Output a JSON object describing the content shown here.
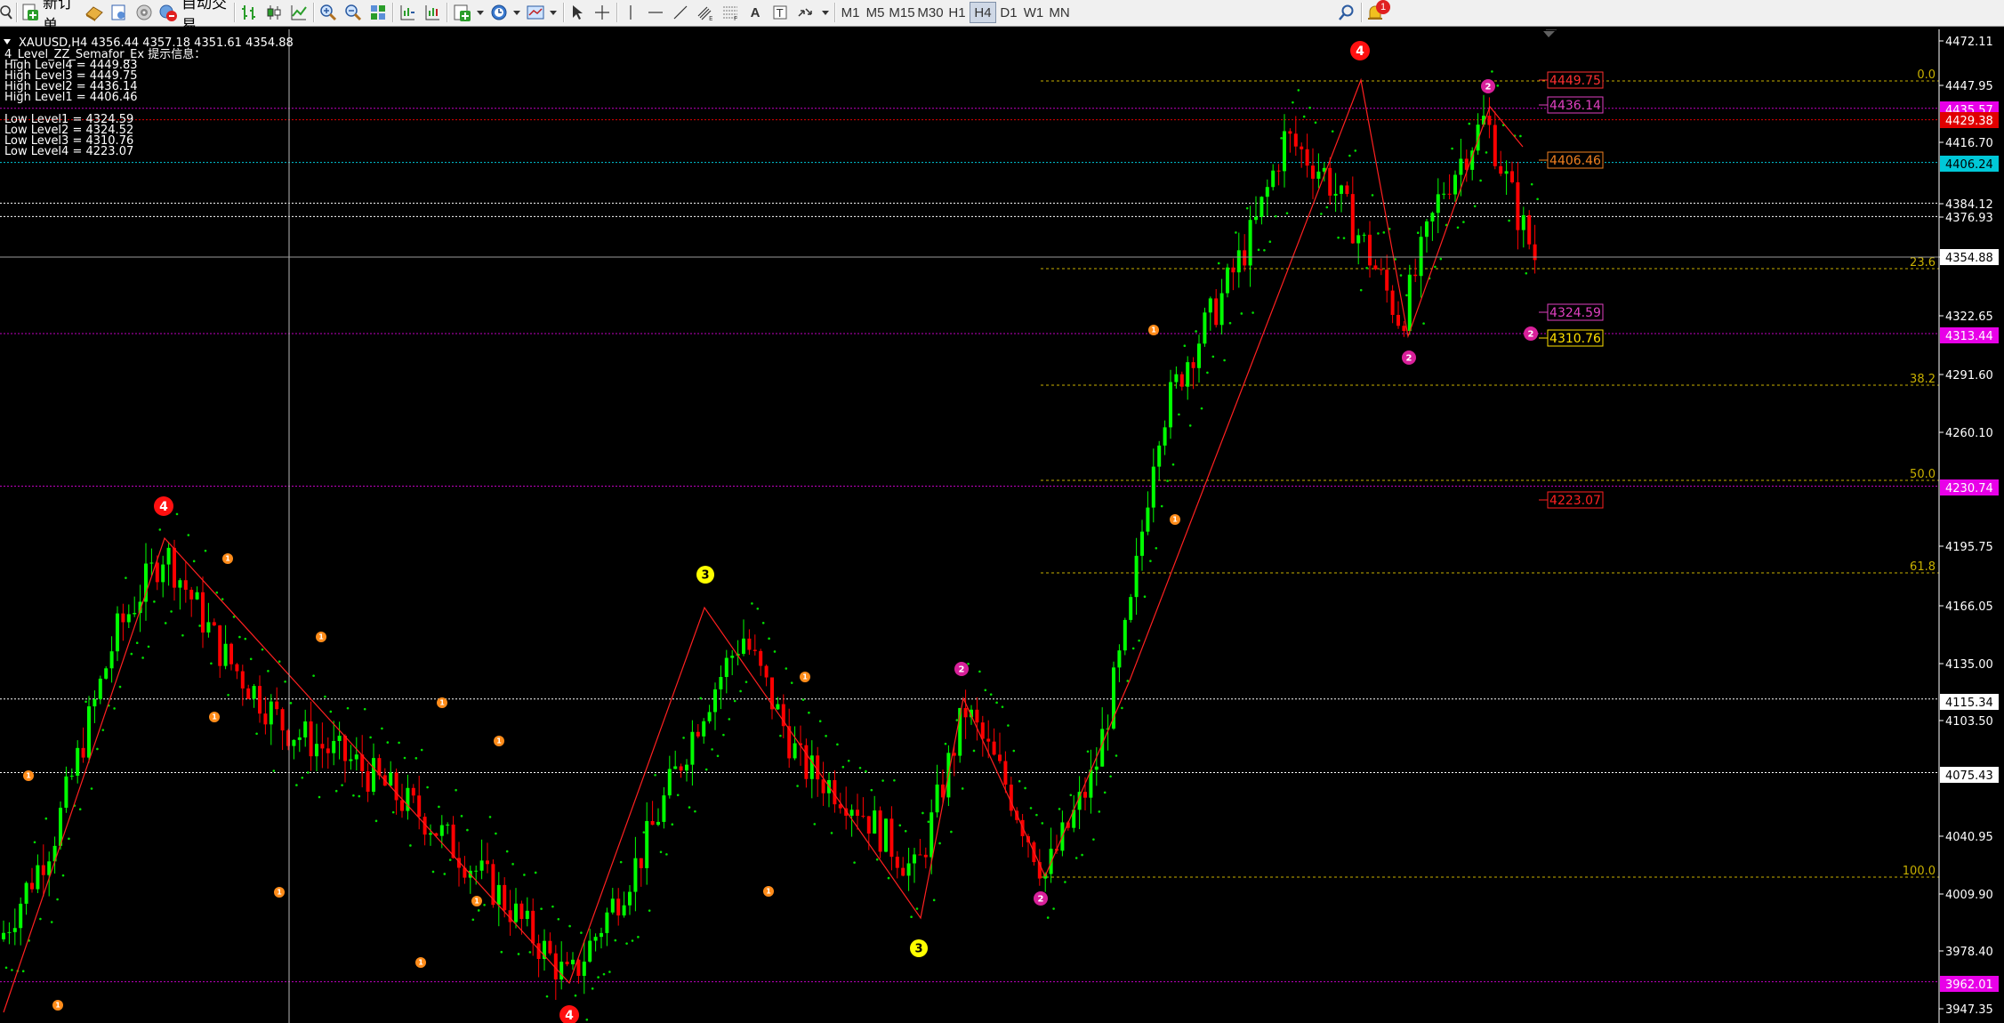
{
  "toolbar": {
    "new_order": "新订单",
    "auto_trade": "自动交易",
    "timeframes": [
      "M1",
      "M5",
      "M15",
      "M30",
      "H1",
      "H4",
      "D1",
      "W1",
      "MN"
    ],
    "active_timeframe": "H4",
    "notification_count": "1",
    "icons": [
      "zoom-icon",
      "new-order-icon",
      "market-watch-icon",
      "navigator-icon",
      "signal-icon",
      "auto-trading-icon",
      "bar-chart-icon",
      "candle-chart-icon",
      "line-chart-icon",
      "zoom-in-icon",
      "zoom-out-icon",
      "tile-windows-icon",
      "chart-shift-icon",
      "autoscroll-icon",
      "indicators-icon",
      "periods-icon",
      "templates-icon",
      "cursor-icon",
      "crosshair-icon",
      "vertical-line-icon",
      "horizontal-line-icon",
      "trendline-icon",
      "equidistant-channel-icon",
      "fibonacci-icon",
      "text-icon",
      "text-label-icon",
      "arrows-icon",
      "search-icon",
      "notification-icon"
    ]
  },
  "chart": {
    "header": "XAUUSD,H4  4356.44 4357.18 4351.61 4354.88",
    "indicator_title": "4_Level_ZZ_Semafor_Ex 提示信息：",
    "high_levels": [
      "High Level4 = 4449.83",
      "High Level3 = 4449.75",
      "High Level2 = 4436.14",
      "High Level1 = 4406.46"
    ],
    "low_levels": [
      "Low Level1 = 4324.59",
      "Low Level2 = 4324.52",
      "Low Level3 = 4310.76",
      "Low Level4 = 4223.07"
    ],
    "price_labels": [
      "4472.11",
      "4447.95",
      "4416.70",
      "4384.12",
      "4376.93",
      "4354.88",
      "4322.65",
      "4291.60",
      "4260.10",
      "4195.75",
      "4166.05",
      "4135.00",
      "4103.50",
      "4040.95",
      "4009.90",
      "3978.40",
      "3947.35"
    ],
    "price_tags": [
      {
        "text": "4435.57",
        "color": "#e800e8"
      },
      {
        "text": "4429.38",
        "color": "#e00000"
      },
      {
        "text": "4406.24",
        "color": "#00c8d8"
      },
      {
        "text": "4354.88",
        "color": "#ffffff"
      },
      {
        "text": "4313.44",
        "color": "#e800e8"
      },
      {
        "text": "4230.74",
        "color": "#e800e8"
      },
      {
        "text": "4115.34",
        "color": "#ffffff"
      },
      {
        "text": "4075.43",
        "color": "#ffffff"
      },
      {
        "text": "3962.01",
        "color": "#e800e8"
      }
    ],
    "fib_labels": [
      "0.0",
      "23.6",
      "38.2",
      "50.0",
      "61.8",
      "100.0"
    ],
    "level_boxes": [
      {
        "text": "4449.75",
        "color": "#ff3030"
      },
      {
        "text": "4436.14",
        "color": "#e040c0"
      },
      {
        "text": "4406.46",
        "color": "#f08020"
      },
      {
        "text": "4324.59",
        "color": "#e040c0"
      },
      {
        "text": "4310.76",
        "color": "#ffe000"
      },
      {
        "text": "4223.07",
        "color": "#ff2020"
      }
    ],
    "semafor_labels": [
      "1",
      "2",
      "3",
      "4"
    ],
    "colors": {
      "bull": "#00ff00",
      "bear": "#ff0000",
      "zigzag": "#ff2020",
      "sar": "#00e000",
      "fib": "#c8b000",
      "purple_line": "#c000c0"
    }
  }
}
